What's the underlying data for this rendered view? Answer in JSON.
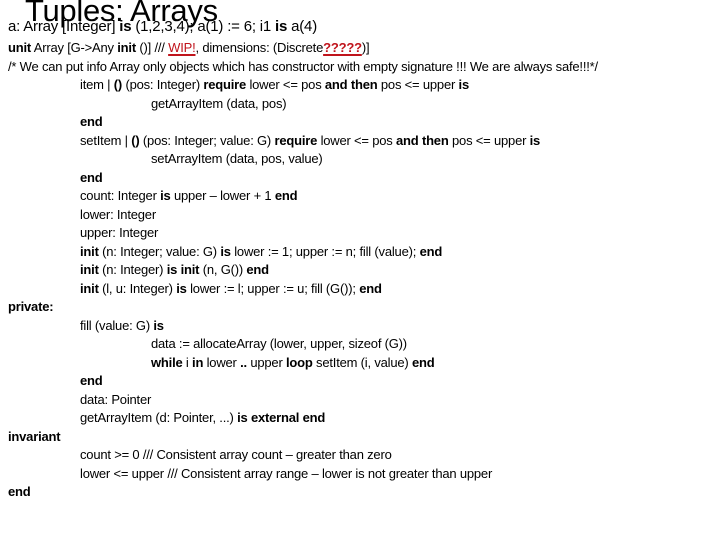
{
  "slide": {
    "title": "Tuples: Arrays",
    "accent_color": "#c0141c",
    "lines": {
      "a_decl": {
        "p1": "a:  Array [Integer] ",
        "k1": "is",
        "p2": " (1,2,3,4); a(1) := 6; i1 ",
        "k2": "is",
        "p3": " a(4)"
      },
      "unit_decl": {
        "k1": "unit",
        "p1": " Array [G->Any ",
        "k2": "init",
        "p2": " ()]  ///   ",
        "wip": "WIP!",
        "p3": ", dimensions: (Discrete",
        "q": "?????",
        "p4": ")]"
      },
      "comment": "/* We can put info Array only objects which has constructor with empty signature !!! We are always safe!!!*/",
      "item_sig": {
        "p1": "item  | ",
        "k1": "()",
        "p2": " (pos: Integer) ",
        "k2": "require",
        "p3": " lower <= pos ",
        "k3": "and then",
        "p4": " pos <= upper ",
        "k4": "is"
      },
      "item_body": "getArrayItem (data, pos)",
      "end1": "end",
      "setitem_sig": {
        "p1": "setItem | ",
        "k1": "()",
        "p2": " (pos: Integer; value: G) ",
        "k2": "require",
        "p3": " lower <= pos ",
        "k3": "and then",
        "p4": " pos <= upper  ",
        "k4": "is"
      },
      "setitem_body": "setArrayItem (data, pos, value)",
      "end2": "end",
      "count": {
        "p1": "count: Integer ",
        "k1": "is",
        "p2": "  upper – lower + 1 ",
        "k2": "end"
      },
      "lower": "lower: Integer",
      "upper": "upper: Integer",
      "init1": {
        "k1": "init",
        "p1": " (n: Integer; value: G) ",
        "k2": "is",
        "p2": " lower := 1; upper := n; fill (value); ",
        "k3": "end"
      },
      "init2": {
        "k1": "init",
        "p1": " (n: Integer) ",
        "k2": "is",
        "p2": " ",
        "k3": "init",
        "p3": " (n, G()) ",
        "k4": "end"
      },
      "init3": {
        "k1": "init",
        "p1": " (l, u: Integer) ",
        "k2": "is",
        "p2": " lower := l; upper := u; fill (G()); ",
        "k3": "end"
      },
      "private": "private:",
      "fill_sig": {
        "p1": "fill (value: G) ",
        "k1": "is"
      },
      "fill_alloc": "data := allocateArray (lower, upper, sizeof (G))",
      "fill_loop": {
        "k1": "while",
        "p1": " i ",
        "k2": "in",
        "p2": " lower ",
        "k3": "..",
        "p3": " upper ",
        "k4": "loop",
        "p4": "  setItem (i, value) ",
        "k5": "end"
      },
      "end3": "end",
      "data_ptr": "data: Pointer",
      "getarray": {
        "p1": "getArrayItem (d: Pointer, ...) ",
        "k1": "is external end"
      },
      "invariant": "invariant",
      "inv1": "count >= 0 /// Consistent array count – greater than zero",
      "inv2": "lower <= upper /// Consistent  array range – lower is not greater than upper",
      "end_final": "end"
    }
  }
}
